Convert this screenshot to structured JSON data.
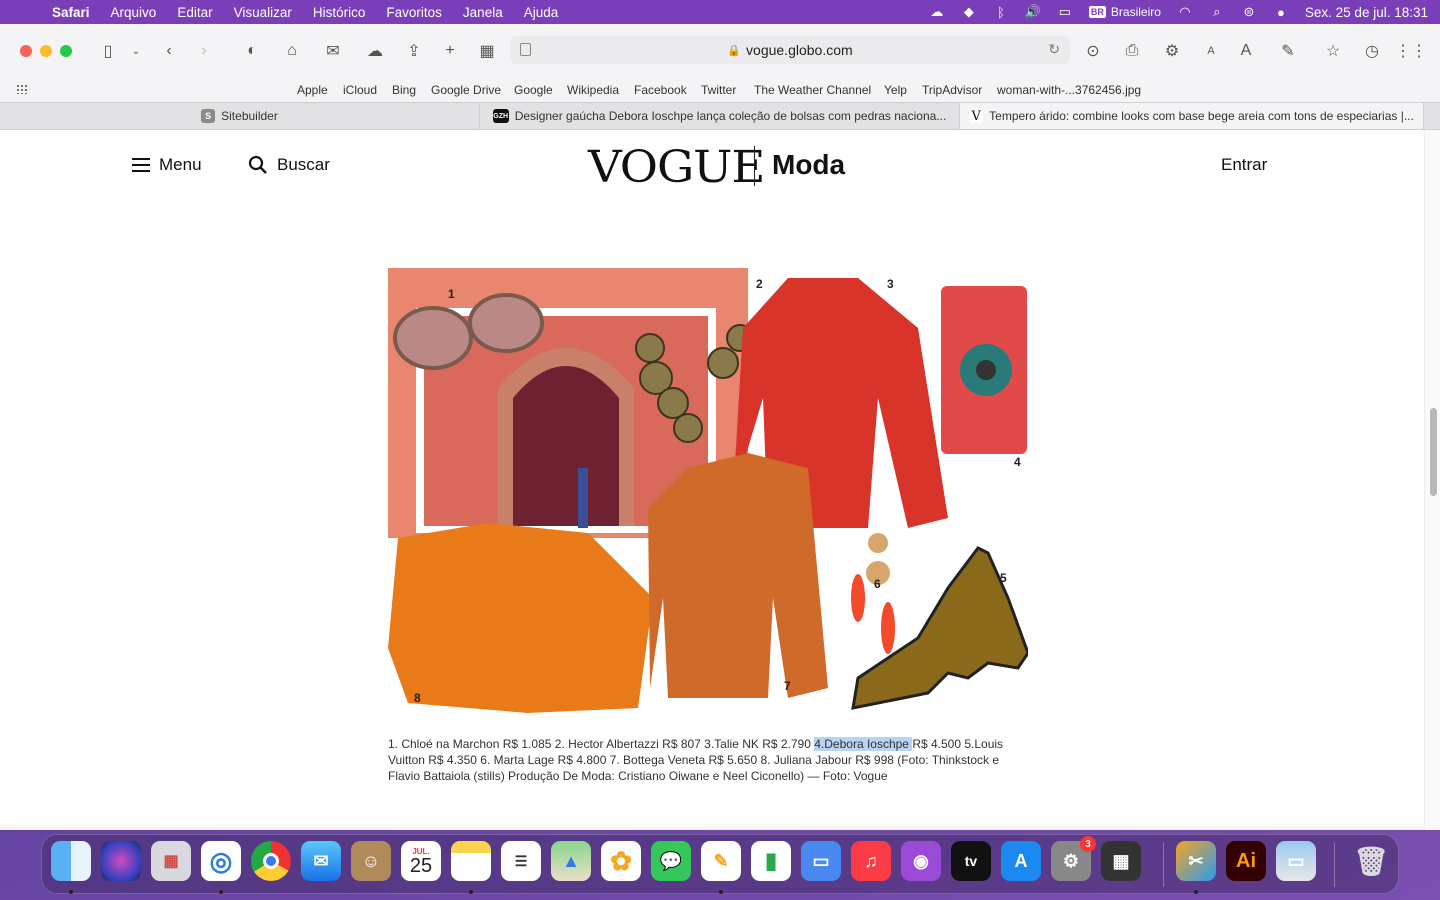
{
  "menubar": {
    "items": [
      "Safari",
      "Arquivo",
      "Editar",
      "Visualizar",
      "Histórico",
      "Favoritos",
      "Janela",
      "Ajuda"
    ],
    "keyboard_badge": "BR",
    "keyboard_label": "Brasileiro",
    "clock": "Sex. 25 de jul.  18:31"
  },
  "browser": {
    "url": "vogue.globo.com",
    "favorites": [
      "Apple",
      "iCloud",
      "Bing",
      "Google Drive",
      "Google",
      "Wikipedia",
      "Facebook",
      "Twitter",
      "The Weather Channel",
      "Yelp",
      "TripAdvisor",
      "woman-with-...3762456.jpg"
    ],
    "tabs": [
      {
        "icon": "S",
        "title": "Sitebuilder",
        "color": "#8a8a8a"
      },
      {
        "icon": "GZH",
        "title": "Designer gaúcha Debora Ioschpe lança coleção de bolsas com pedras naciona...",
        "color": "#111111"
      },
      {
        "icon": "V",
        "title": "Tempero árido: combine looks com base bege areia com tons de especiarias |...",
        "color": "#ffffff"
      }
    ]
  },
  "site": {
    "menu_label": "Menu",
    "search_label": "Buscar",
    "logo": "VOGUE",
    "section": "Moda",
    "login_label": "Entrar"
  },
  "figure": {
    "numbers": [
      "1",
      "2",
      "3",
      "4",
      "5",
      "6",
      "7",
      "8"
    ]
  },
  "caption": {
    "before": "1. Chloé na Marchon R$ 1.085 2. Hector Albertazzi R$ 807 3.Talie NK R$ 2.790 ",
    "highlight": "4.Debora Ioschpe ",
    "after": "R$ 4.500 5.Louis Vuitton R$ 4.350 6. Marta Lage R$ 4.800 7. Bottega Veneta R$ 5.650 8. Juliana Jabour R$ 998 (Foto: Thinkstock e Flavio Battaiola (stills) Produção De Moda: Cristiano Oiwane e Neel Ciconello) — Foto: Vogue"
  },
  "dock": {
    "calendar_month": "JUL.",
    "calendar_day": "25",
    "settings_badge": "3",
    "illustrator_label": "Ai",
    "tv_label": "tv"
  }
}
